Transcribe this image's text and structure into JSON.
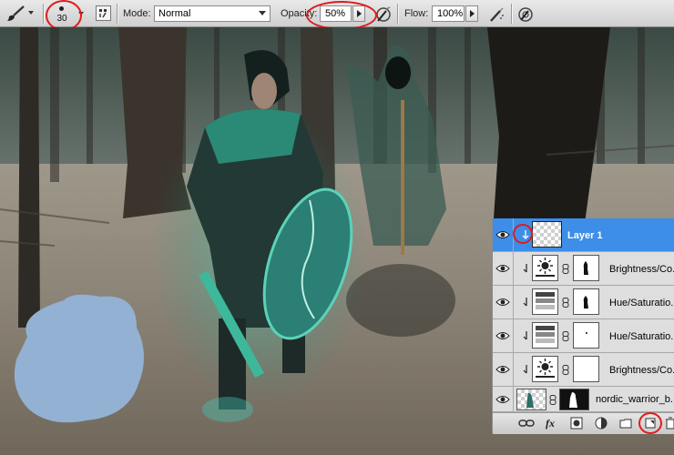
{
  "options_bar": {
    "tool_icon": "brush-icon",
    "brush_size": "30",
    "panel_toggle_icon": "brush-panel-icon",
    "mode_label": "Mode:",
    "mode_value": "Normal",
    "opacity_label": "Opacity:",
    "opacity_value": "50%",
    "flow_label": "Flow:",
    "flow_value": "100%",
    "airbrush_icon": "airbrush-icon",
    "pressure_opacity_icon": "pen-pressure-opacity-icon",
    "pressure_size_icon": "pen-pressure-size-icon"
  },
  "annotation_color": "#e01b1b",
  "canvas": {
    "scene": "forest-photo-composite",
    "painted_blob_color": "#93b1d2",
    "teal_glow_color": "#29c7a8"
  },
  "layers_panel": {
    "selected_color": "#3d8ee8",
    "layers": [
      {
        "name": "Layer 1",
        "selected": true,
        "clipped": true,
        "type": "pixel"
      },
      {
        "name": "Brightness/Co...",
        "selected": false,
        "clipped": true,
        "type": "brightness"
      },
      {
        "name": "Hue/Saturatio...",
        "selected": false,
        "clipped": true,
        "type": "hue"
      },
      {
        "name": "Hue/Saturatio...",
        "selected": false,
        "clipped": true,
        "type": "hue"
      },
      {
        "name": "Brightness/Co...",
        "selected": false,
        "clipped": true,
        "type": "brightness"
      },
      {
        "name": "nordic_warrior_b...",
        "selected": false,
        "clipped": false,
        "type": "image"
      }
    ],
    "bottom_icons": [
      "link-layers-icon",
      "fx-icon",
      "add-mask-icon",
      "adjustment-layer-icon",
      "group-folder-icon",
      "new-layer-icon",
      "delete-layer-icon"
    ]
  }
}
